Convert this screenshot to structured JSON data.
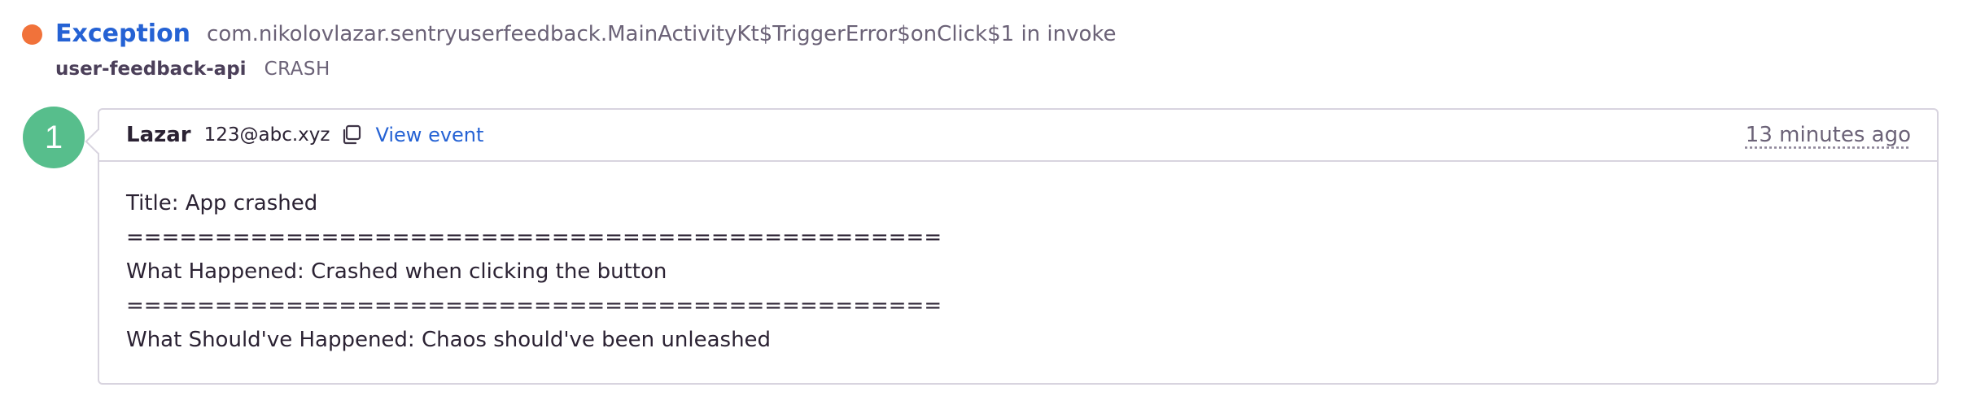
{
  "issue": {
    "type": "Exception",
    "culprit": "com.nikolovlazar.sentryuserfeedback.MainActivityKt$TriggerError$onClick$1 in invoke",
    "project": "user-feedback-api",
    "tag": "CRASH",
    "level_color": "#f1723a"
  },
  "feedback": {
    "avatar_initial": "1",
    "avatar_color": "#57be8c",
    "user_name": "Lazar",
    "user_email": "123@abc.xyz",
    "copy_icon": "copy-icon",
    "view_event_label": "View event",
    "timestamp": "13 minutes ago",
    "message_lines": [
      "Title: App crashed",
      "==============================================",
      "What Happened: Crashed when clicking the button",
      "==============================================",
      "What Should've Happened: Chaos should've been unleashed"
    ]
  },
  "colors": {
    "link": "#2562d4",
    "border": "#d8d4df",
    "muted_text": "#6b6277"
  }
}
